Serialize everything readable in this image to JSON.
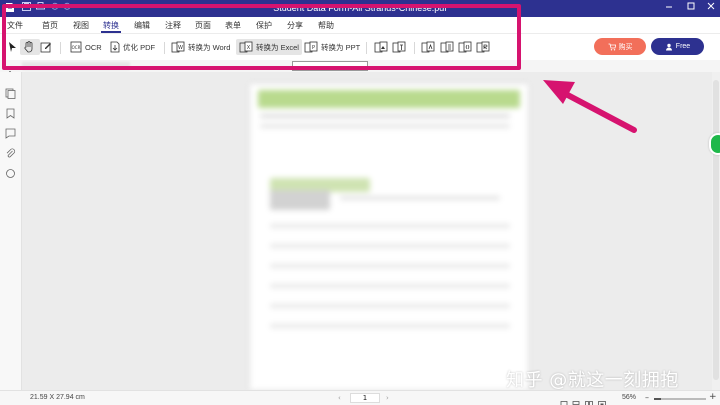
{
  "window": {
    "title": "Student Data Form-All Strands-Chinese.pdf"
  },
  "menu": {
    "items": [
      "文件",
      "首页",
      "视图",
      "转换",
      "编辑",
      "注释",
      "页面",
      "表单",
      "保护",
      "分享",
      "帮助"
    ],
    "active_index": 3
  },
  "toolbar": {
    "ocr": "OCR",
    "optimize_pdf": "优化 PDF",
    "to_word": "转换为 Word",
    "to_excel": "转换为 Excel",
    "to_ppt": "转换为 PPT",
    "buy_label": "购买",
    "free_label": "Free"
  },
  "watermark": "知乎 @就这一刻拥抱",
  "status": {
    "page_size": "21.59 X 27.94 cm",
    "page_number": "1",
    "zoom": "56%"
  },
  "colors": {
    "brand": "#2d3190",
    "buy": "#f26f5a",
    "annotation": "#d6136f"
  }
}
